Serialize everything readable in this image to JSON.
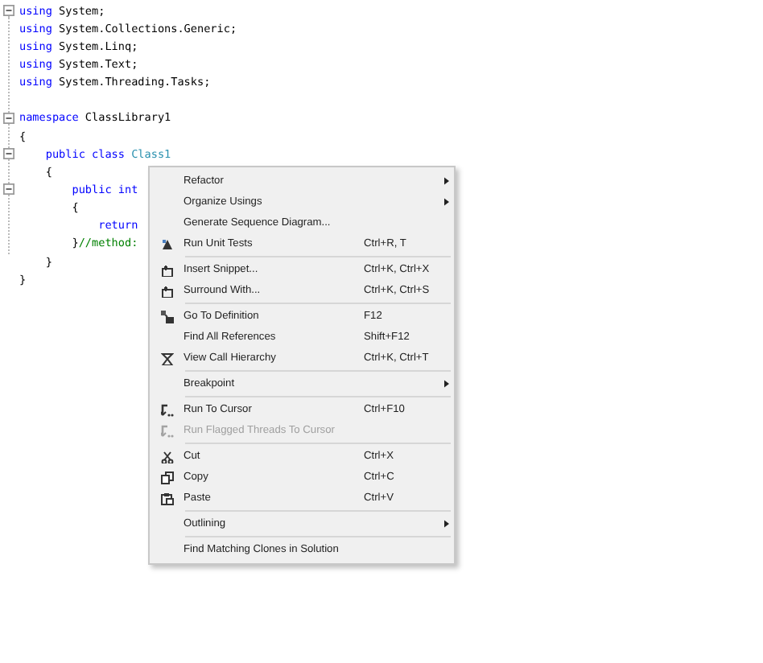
{
  "code_lines": [
    {
      "kind": "fold",
      "expanded": true,
      "tokens": [
        {
          "kind": "keyword",
          "text": "using"
        },
        {
          "kind": "plain",
          "text": " System;"
        }
      ]
    },
    {
      "kind": "line",
      "tokens": [
        {
          "kind": "keyword",
          "text": "using"
        },
        {
          "kind": "plain",
          "text": " System.Collections.Generic;"
        }
      ]
    },
    {
      "kind": "line",
      "tokens": [
        {
          "kind": "keyword",
          "text": "using"
        },
        {
          "kind": "plain",
          "text": " System.Linq;"
        }
      ]
    },
    {
      "kind": "line",
      "tokens": [
        {
          "kind": "keyword",
          "text": "using"
        },
        {
          "kind": "plain",
          "text": " System.Text;"
        }
      ]
    },
    {
      "kind": "line",
      "tokens": [
        {
          "kind": "keyword",
          "text": "using"
        },
        {
          "kind": "plain",
          "text": " System.Threading.Tasks;"
        }
      ]
    },
    {
      "kind": "blank"
    },
    {
      "kind": "fold",
      "expanded": true,
      "tokens": [
        {
          "kind": "keyword",
          "text": "namespace"
        },
        {
          "kind": "plain",
          "text": " ClassLibrary1"
        }
      ]
    },
    {
      "kind": "line",
      "tokens": [
        {
          "kind": "plain",
          "text": "{"
        }
      ]
    },
    {
      "kind": "fold",
      "expanded": true,
      "tokens": [
        {
          "kind": "keyword",
          "text": "    public class"
        },
        {
          "kind": "type",
          "text": " Class1"
        }
      ]
    },
    {
      "kind": "line",
      "tokens": [
        {
          "kind": "plain",
          "text": "    {"
        }
      ]
    },
    {
      "kind": "fold",
      "expanded": true,
      "tokens": [
        {
          "kind": "keyword",
          "text": "        public int"
        }
      ]
    },
    {
      "kind": "line",
      "tokens": [
        {
          "kind": "plain",
          "text": "        {"
        }
      ]
    },
    {
      "kind": "line",
      "tokens": [
        {
          "kind": "keyword",
          "text": "            return"
        }
      ]
    },
    {
      "kind": "line",
      "tokens": [
        {
          "kind": "plain",
          "text": "        }"
        },
        {
          "kind": "comment",
          "text": "//method:"
        }
      ]
    },
    {
      "kind": "line",
      "tokens": [
        {
          "kind": "plain",
          "text": "    }"
        }
      ]
    },
    {
      "kind": "line",
      "tokens": [
        {
          "kind": "plain",
          "text": "}"
        }
      ]
    }
  ],
  "context_menu": [
    {
      "kind": "item",
      "label": "Refactor",
      "submenu": true,
      "disabled": false
    },
    {
      "kind": "item",
      "label": "Organize Usings",
      "submenu": true,
      "disabled": false
    },
    {
      "kind": "item",
      "label": "Generate Sequence Diagram...",
      "submenu": false,
      "disabled": false
    },
    {
      "kind": "item",
      "label": "Run Unit Tests",
      "shortcut": "Ctrl+R, T",
      "submenu": false,
      "disabled": false
    },
    {
      "kind": "separator"
    },
    {
      "kind": "item",
      "label": "Insert Snippet...",
      "shortcut": "Ctrl+K, Ctrl+X",
      "submenu": false,
      "disabled": false
    },
    {
      "kind": "item",
      "label": "Surround With...",
      "shortcut": "Ctrl+K, Ctrl+S",
      "submenu": false,
      "disabled": false
    },
    {
      "kind": "separator"
    },
    {
      "kind": "item",
      "label": "Go To Definition",
      "shortcut": "F12",
      "submenu": false,
      "disabled": false
    },
    {
      "kind": "item",
      "label": "Find All References",
      "shortcut": "Shift+F12",
      "submenu": false,
      "disabled": false
    },
    {
      "kind": "item",
      "label": "View Call Hierarchy",
      "shortcut": "Ctrl+K, Ctrl+T",
      "submenu": false,
      "disabled": false
    },
    {
      "kind": "separator"
    },
    {
      "kind": "item",
      "label": "Breakpoint",
      "submenu": true,
      "disabled": false
    },
    {
      "kind": "separator"
    },
    {
      "kind": "item",
      "label": "Run To Cursor",
      "shortcut": "Ctrl+F10",
      "submenu": false,
      "disabled": false
    },
    {
      "kind": "item",
      "label": "Run Flagged Threads To Cursor",
      "submenu": false,
      "disabled": true
    },
    {
      "kind": "separator"
    },
    {
      "kind": "item",
      "label": "Cut",
      "shortcut": "Ctrl+X",
      "submenu": false,
      "disabled": false
    },
    {
      "kind": "item",
      "label": "Copy",
      "shortcut": "Ctrl+C",
      "submenu": false,
      "disabled": false
    },
    {
      "kind": "item",
      "label": "Paste",
      "shortcut": "Ctrl+V",
      "submenu": false,
      "disabled": false
    },
    {
      "kind": "separator"
    },
    {
      "kind": "item",
      "label": "Outlining",
      "submenu": true,
      "disabled": false
    },
    {
      "kind": "separator"
    },
    {
      "kind": "item",
      "label": "Find Matching Clones in Solution",
      "submenu": false,
      "disabled": false
    }
  ]
}
